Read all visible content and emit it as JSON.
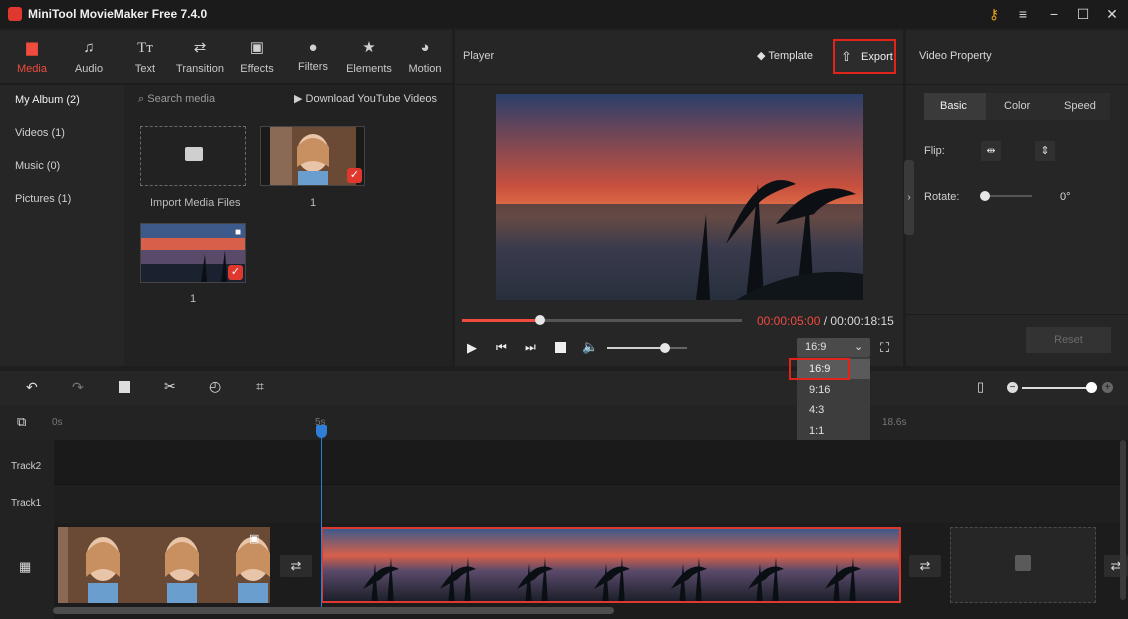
{
  "window": {
    "title": "MiniTool MovieMaker Free 7.4.0"
  },
  "media_tabs": [
    {
      "label": "Media",
      "icon": "folder-icon",
      "active": true
    },
    {
      "label": "Audio",
      "icon": "music-note-icon",
      "active": false
    },
    {
      "label": "Text",
      "icon": "text-icon",
      "active": false
    },
    {
      "label": "Transition",
      "icon": "transition-arrows-icon",
      "active": false
    },
    {
      "label": "Effects",
      "icon": "effects-icon",
      "active": false
    },
    {
      "label": "Filters",
      "icon": "filters-icon",
      "active": false
    },
    {
      "label": "Elements",
      "icon": "elements-icon",
      "active": false
    },
    {
      "label": "Motion",
      "icon": "motion-icon",
      "active": false
    }
  ],
  "album": {
    "items": [
      "My Album (2)",
      "Videos (1)",
      "Music (0)",
      "Pictures (1)"
    ]
  },
  "media": {
    "search_placeholder": "Search media",
    "download_label": "Download YouTube Videos",
    "import_label": "Import Media Files",
    "thumb1_label": "1",
    "thumb2_label": "1"
  },
  "player": {
    "title": "Player",
    "template_label": "Template",
    "export_label": "Export",
    "current_time": "00:00:05:00",
    "separator": " / ",
    "total_time": "00:00:18:15",
    "progress": 0.28,
    "volume": 0.73,
    "aspect_selected": "16:9",
    "aspect_options": [
      "16:9",
      "9:16",
      "4:3",
      "1:1"
    ]
  },
  "properties": {
    "title": "Video Property",
    "tabs": [
      "Basic",
      "Color",
      "Speed"
    ],
    "flip_label": "Flip:",
    "rotate_label": "Rotate:",
    "rotate_value": "0°",
    "reset_label": "Reset"
  },
  "timeline": {
    "ruler": [
      "0s",
      "5s",
      "18.6s"
    ],
    "tracks": [
      "Track2",
      "Track1"
    ]
  },
  "colors": {
    "accent": "#ef4b3f",
    "highlight_box": "#e0231b",
    "playhead": "#2f7fd8"
  }
}
